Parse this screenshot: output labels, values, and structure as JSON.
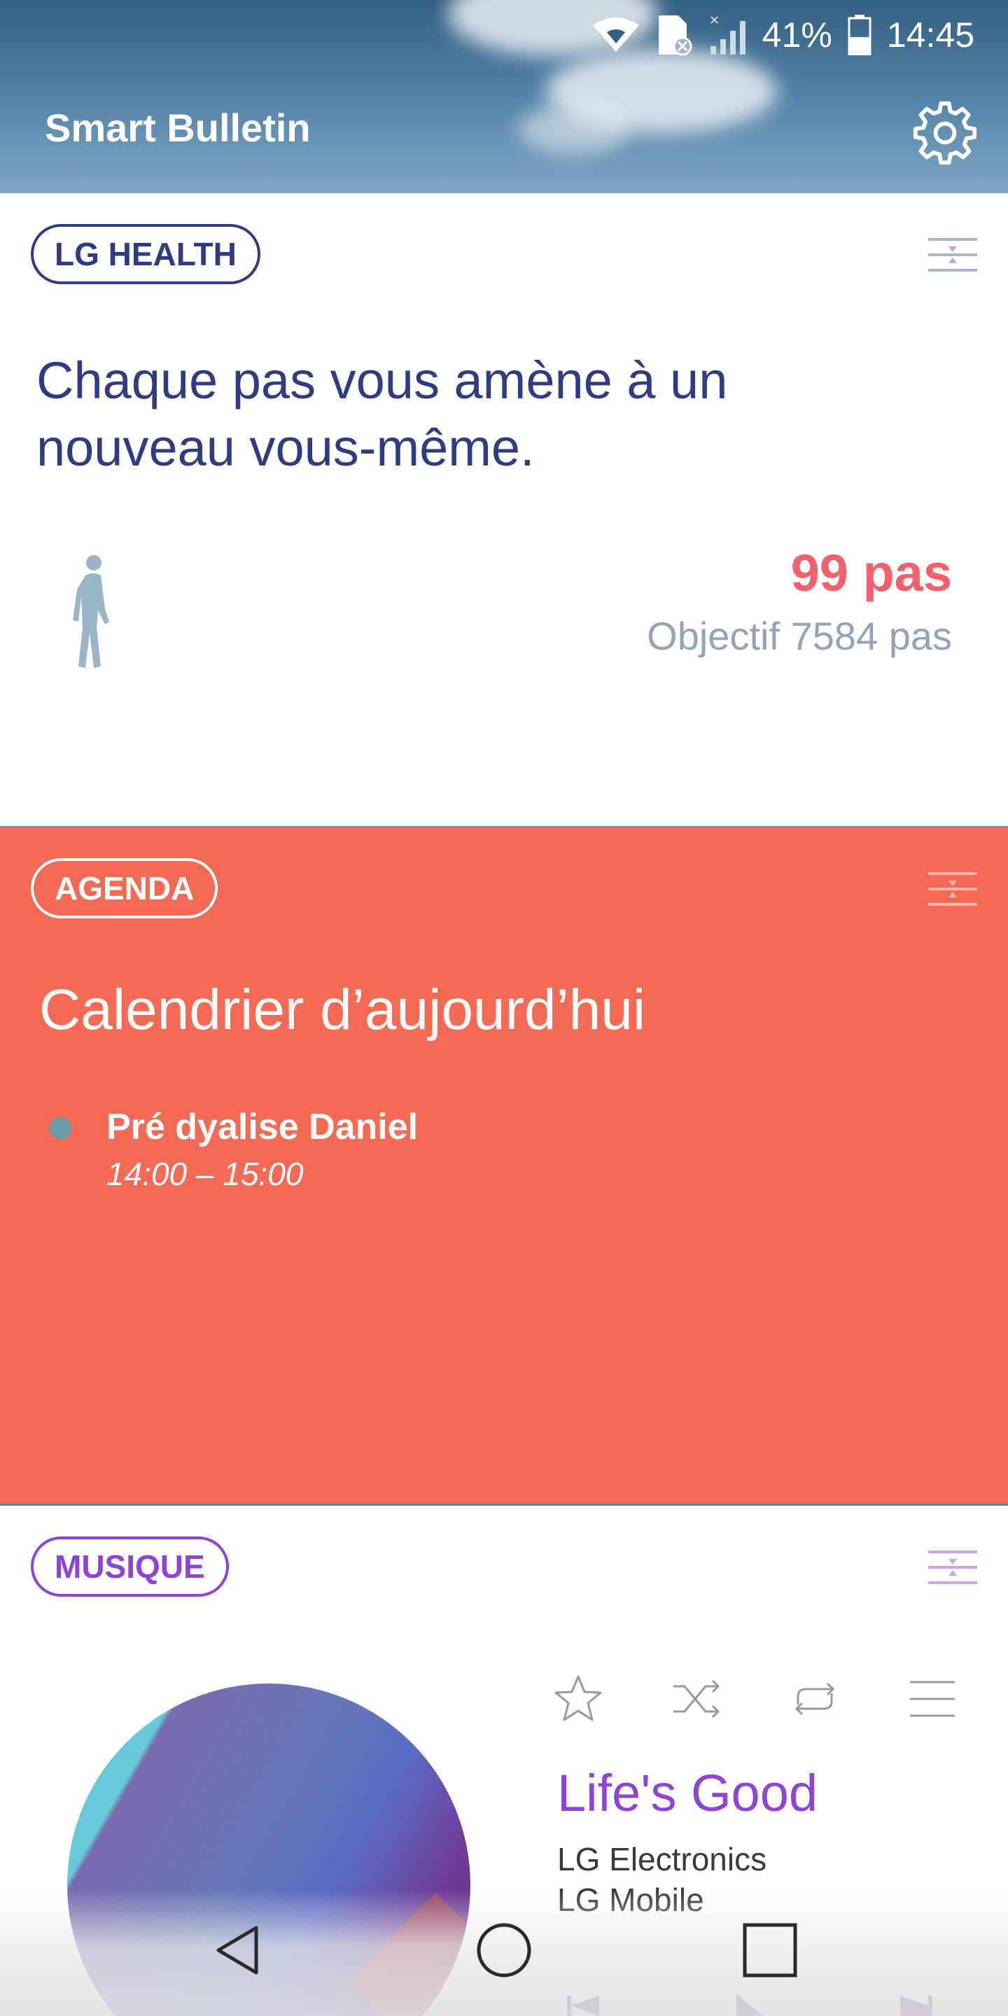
{
  "status_bar": {
    "battery": "41%",
    "time": "14:45",
    "icons": [
      "wifi-icon",
      "sim-no-service-icon",
      "signal-icon",
      "battery-icon"
    ]
  },
  "header": {
    "title": "Smart Bulletin",
    "settings_icon": "gear-icon"
  },
  "health": {
    "tag": "LG HEALTH",
    "message": "Chaque pas vous amène à un nouveau vous-même.",
    "steps": "99 pas",
    "goal": "Objectif 7584 pas",
    "progress_fraction": 0.013,
    "accent": "#f4606b"
  },
  "agenda": {
    "tag": "AGENDA",
    "title": "Calendrier d’aujourd’hui",
    "events": [
      {
        "title": "Pré dyalise Daniel",
        "time": "14:00 – 15:00"
      }
    ],
    "background": "#f56a55"
  },
  "music": {
    "tag": "MUSIQUE",
    "title": "Life's Good",
    "artist": "LG Electronics",
    "album": "LG Mobile",
    "controls": [
      "star-icon",
      "shuffle-icon",
      "repeat-icon",
      "playlist-icon"
    ],
    "accent": "#8e43d9"
  },
  "navbar": {
    "buttons": [
      "back-icon",
      "home-icon",
      "recents-icon"
    ]
  }
}
